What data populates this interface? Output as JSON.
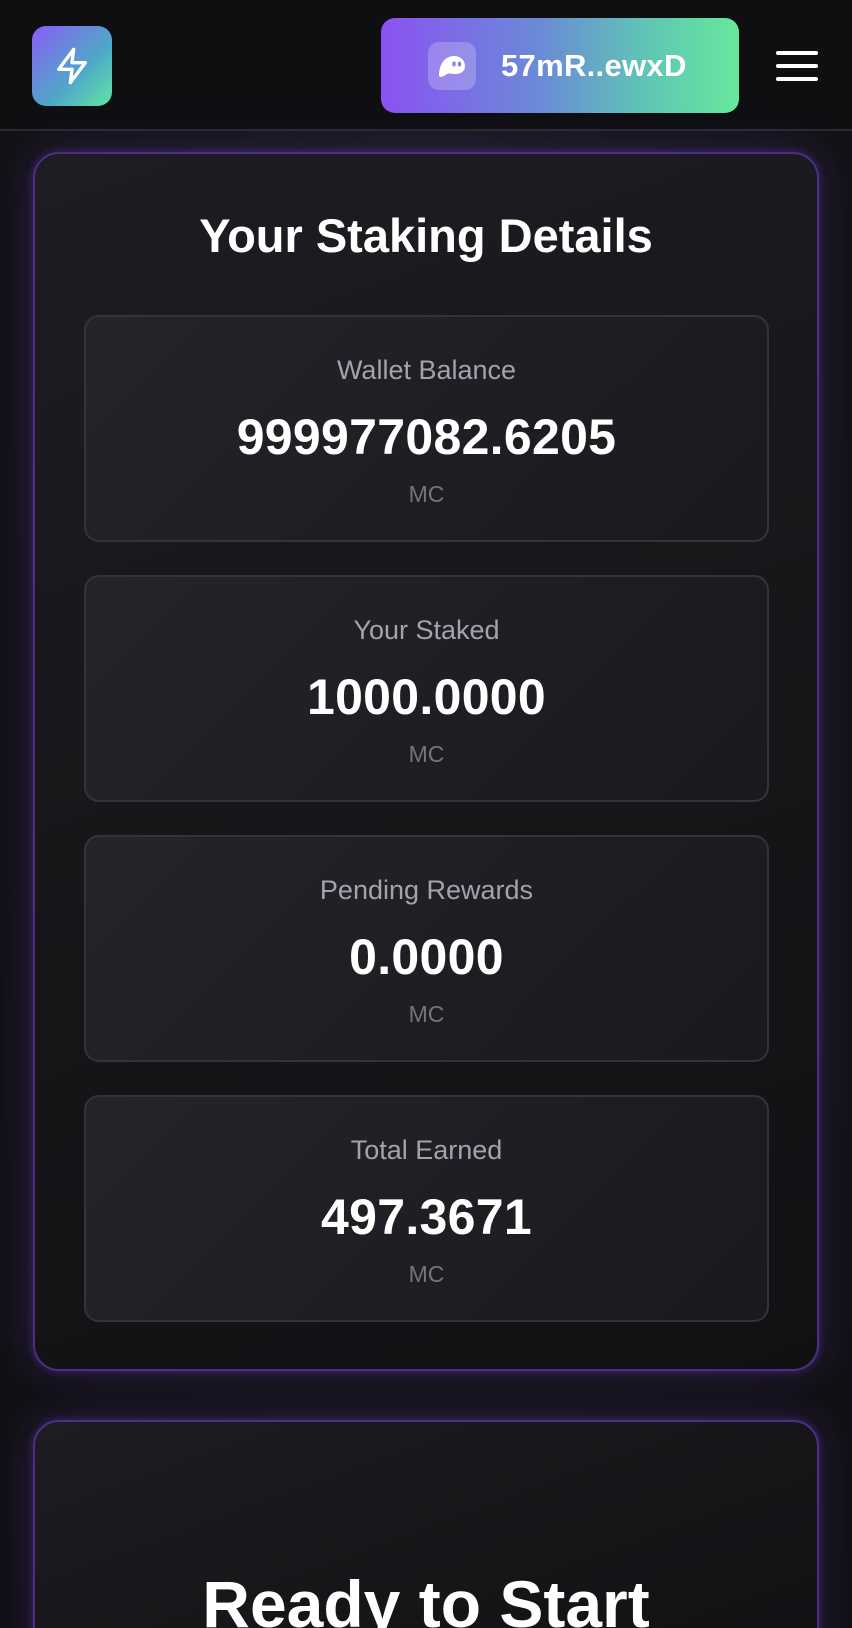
{
  "header": {
    "logo_icon": "lightning-bolt-icon",
    "wallet": {
      "icon": "ghost-icon",
      "address": "57mR..ewxD"
    },
    "menu_icon": "hamburger-menu-icon"
  },
  "staking": {
    "title": "Your Staking Details",
    "stats": [
      {
        "label": "Wallet Balance",
        "value": "999977082.6205",
        "unit": "MC"
      },
      {
        "label": "Your Staked",
        "value": "1000.0000",
        "unit": "MC"
      },
      {
        "label": "Pending Rewards",
        "value": "0.0000",
        "unit": "MC"
      },
      {
        "label": "Total Earned",
        "value": "497.3671",
        "unit": "MC"
      }
    ]
  },
  "start": {
    "title": "Ready to Start"
  },
  "colors": {
    "accent_purple": "#8b5cf6",
    "accent_green": "#66e89c",
    "card_border": "#4b2f86",
    "background": "#141418"
  }
}
